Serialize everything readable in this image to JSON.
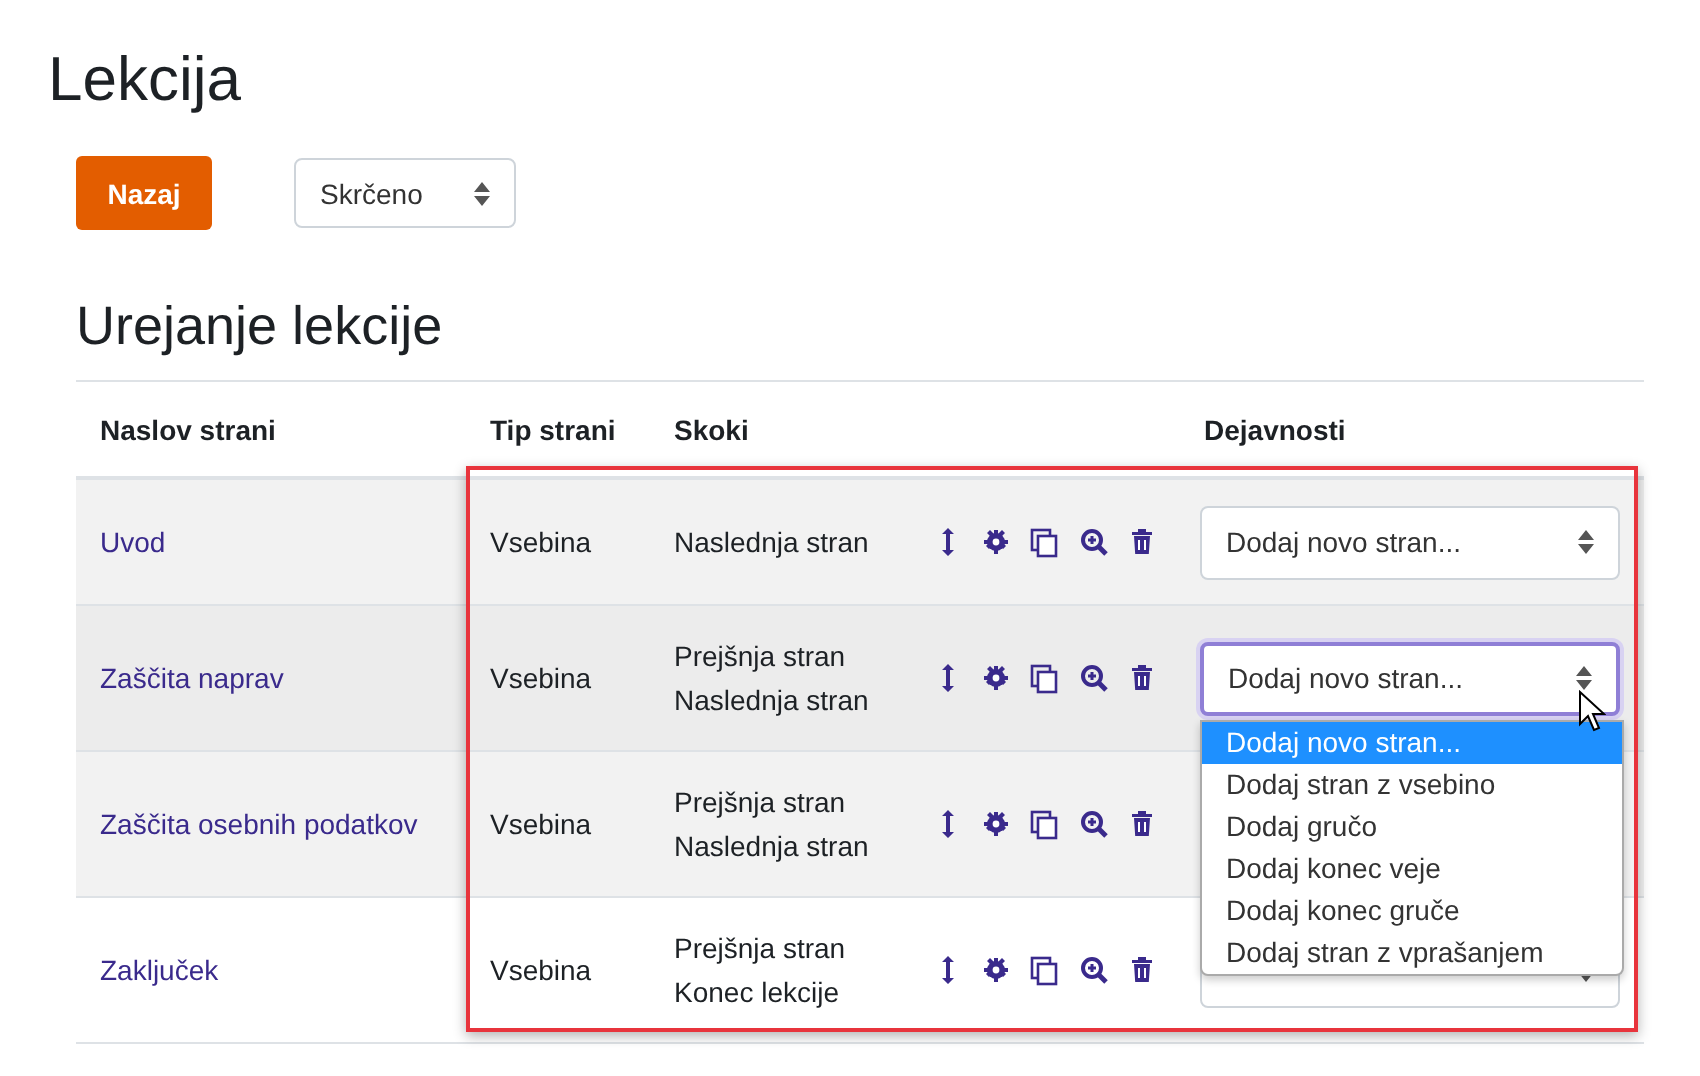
{
  "title": "Lekcija",
  "back_button": "Nazaj",
  "view_select": {
    "value": "Skrčeno"
  },
  "section_title": "Urejanje lekcije",
  "table": {
    "columns": [
      "Naslov strani",
      "Tip strani",
      "Skoki",
      "",
      "Dejavnosti"
    ],
    "rows": [
      {
        "title": "Uvod",
        "type": "Vsebina",
        "jumps": [
          "Naslednja stran"
        ],
        "action": {
          "value": "Dodaj novo stran...",
          "focused": false
        }
      },
      {
        "title": "Zaščita naprav",
        "type": "Vsebina",
        "jumps": [
          "Prejšnja stran",
          "Naslednja stran"
        ],
        "action": {
          "value": "Dodaj novo stran...",
          "focused": true
        }
      },
      {
        "title": "Zaščita osebnih podatkov",
        "type": "Vsebina",
        "jumps": [
          "Prejšnja stran",
          "Naslednja stran"
        ]
      },
      {
        "title": "Zaključek",
        "type": "Vsebina",
        "jumps": [
          "Prejšnja stran",
          "Konec lekcije"
        ],
        "action": {
          "focused": false
        }
      }
    ]
  },
  "dropdown": {
    "options": [
      {
        "label": "Dodaj novo stran...",
        "selected": true
      },
      {
        "label": "Dodaj stran z vsebino",
        "selected": false
      },
      {
        "label": "Dodaj gručo",
        "selected": false
      },
      {
        "label": "Dodaj konec veje",
        "selected": false
      },
      {
        "label": "Dodaj konec gruče",
        "selected": false
      },
      {
        "label": "Dodaj stran z vprašanjem",
        "selected": false
      }
    ]
  }
}
